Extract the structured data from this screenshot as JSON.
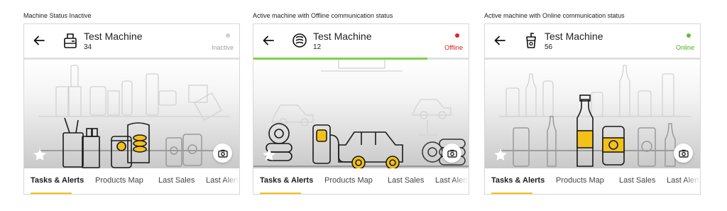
{
  "panels": [
    {
      "caption": "Machine Status Inactive",
      "machine_name": "Test Machine",
      "machine_number": "34",
      "machine_icon": "ticket-machine-icon",
      "status_text": "Inactive",
      "status_color": "#9e9e9e",
      "dot_color": "#cfcfcf",
      "progress": 0,
      "progress_color": "#e0e0e0",
      "scene": "snack-machine-illustration",
      "tabs": [
        "Tasks & Alerts",
        "Products Map",
        "Last Sales",
        "Last Alerts"
      ],
      "active_tab": 0
    },
    {
      "caption": "Active machine with Offline communication status",
      "machine_name": "Test Machine",
      "machine_number": "12",
      "machine_icon": "coil-machine-icon",
      "status_text": "Offline",
      "status_color": "#d21f1f",
      "dot_color": "#e02424",
      "progress": 0.81,
      "progress_color": "#7fd14a",
      "scene": "car-service-illustration",
      "tabs": [
        "Tasks & Alerts",
        "Products Map",
        "Last Sales",
        "Last Alerts"
      ],
      "active_tab": 0
    },
    {
      "caption": "Active machine with Online communication status",
      "machine_name": "Test Machine",
      "machine_number": "56",
      "machine_icon": "drink-cup-icon",
      "status_text": "Online",
      "status_color": "#4caf1d",
      "dot_color": "#5cc230",
      "progress": 1,
      "progress_color": "#e0e0e0",
      "scene": "beverages-illustration",
      "tabs": [
        "Tasks & Alerts",
        "Products Map",
        "Last Sales",
        "Last Alerts"
      ],
      "active_tab": 0
    }
  ],
  "accent_color": "#f2c11a"
}
